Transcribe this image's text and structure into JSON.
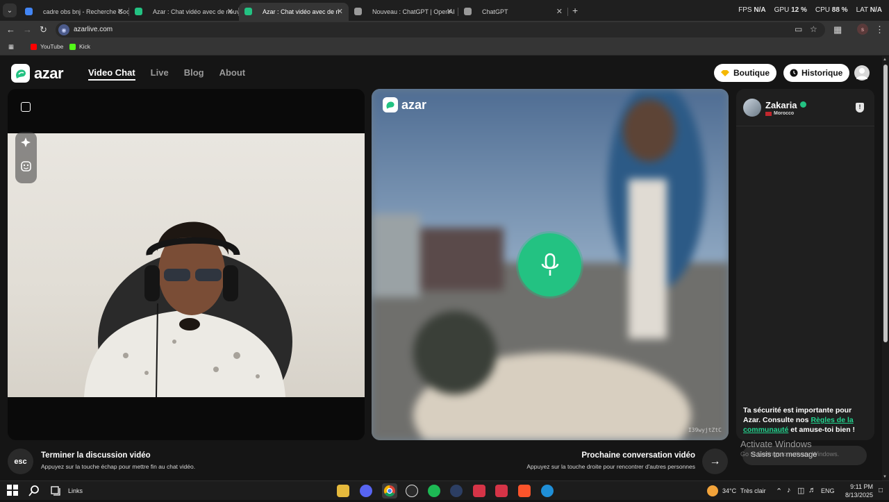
{
  "browser": {
    "tabs": [
      {
        "title": "cadre obs bnj - Recherche Goo",
        "favicon_color": "#4285f4",
        "active": false
      },
      {
        "title": "Azar : Chat vidéo avec de nouv",
        "favicon_color": "#23c282",
        "active": false
      },
      {
        "title": "Azar : Chat vidéo avec de n",
        "favicon_color": "#23c282",
        "active": true
      },
      {
        "title": "Nouveau : ChatGPT | OpenAI",
        "favicon_color": "#9a9a9a",
        "active": false
      },
      {
        "title": "ChatGPT",
        "favicon_color": "#9a9a9a",
        "active": false
      }
    ],
    "url": "azarlive.com",
    "bookmarks": [
      {
        "label": "YouTube",
        "color": "#ff0000"
      },
      {
        "label": "Kick",
        "color": "#53fc18"
      }
    ],
    "profile_initial": "s",
    "overlay": {
      "fps_label": "FPS",
      "fps": "N/A",
      "gpu_label": "GPU",
      "gpu": "12 %",
      "cpu_label": "CPU",
      "cpu": "88 %",
      "lat_label": "LAT",
      "lat": "N/A"
    }
  },
  "site": {
    "logo_text": "azar",
    "nav": [
      {
        "label": "Video Chat",
        "active": true
      },
      {
        "label": "Live",
        "active": false
      },
      {
        "label": "Blog",
        "active": false
      },
      {
        "label": "About",
        "active": false
      }
    ],
    "boutique_label": "Boutique",
    "historique_label": "Historique",
    "remote_watermark": "azar",
    "remote_id": "I39wyjtZtC",
    "chat": {
      "peer_name": "Zakaria",
      "peer_country": "Morocco",
      "safety_pre": "Ta sécurité est importante pour Azar. Consulte nos ",
      "safety_link": "Règles de la communauté",
      "safety_post": " et amuse-toi bien !",
      "input_placeholder": "Saisis ton message"
    },
    "end_action": {
      "key": "esc",
      "title": "Terminer la discussion vidéo",
      "subtitle": "Appuyez sur la touche échap pour mettre fin au chat vidéo."
    },
    "next_action": {
      "title": "Prochaine conversation vidéo",
      "subtitle": "Appuyez sur la touche droite pour rencontrer d'autres personnes"
    },
    "watermark": {
      "title": "Activate Windows",
      "subtitle": "Go to Settings to activate Windows."
    },
    "accent_color": "#23c282"
  },
  "taskbar": {
    "search_label": "Links",
    "weather": "34°C",
    "weather_desc": "Très clair",
    "language": "ENG",
    "time": "9:11 PM",
    "date": "8/13/2025"
  }
}
